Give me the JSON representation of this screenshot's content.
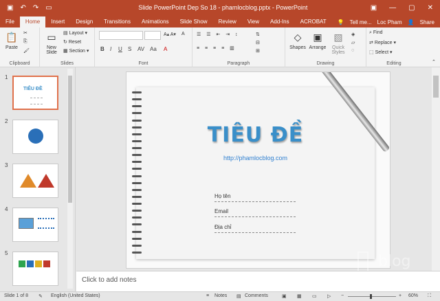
{
  "titlebar": {
    "title": "Slide PowerPoint Dep So 18 - phamlocblog.pptx - PowerPoint",
    "qa_icons": [
      "save-icon",
      "undo-icon",
      "redo-icon",
      "slideshow-icon"
    ],
    "user": "Loc Pham",
    "share": "Share",
    "tell_me": "Tell me..."
  },
  "tabs": [
    "File",
    "Home",
    "Insert",
    "Design",
    "Transitions",
    "Animations",
    "Slide Show",
    "Review",
    "View",
    "Add-Ins",
    "ACROBAT"
  ],
  "ribbon": {
    "clipboard": {
      "label": "Clipboard",
      "paste": "Paste"
    },
    "slides": {
      "label": "Slides",
      "new_slide": "New Slide",
      "layout": "Layout",
      "reset": "Reset",
      "section": "Section"
    },
    "font": {
      "label": "Font",
      "bold": "B",
      "italic": "I",
      "underline": "U",
      "strike": "S"
    },
    "paragraph": {
      "label": "Paragraph"
    },
    "drawing": {
      "label": "Drawing",
      "shapes": "Shapes",
      "arrange": "Arrange",
      "quick_styles": "Quick Styles"
    },
    "editing": {
      "label": "Editing",
      "find": "Find",
      "replace": "Replace",
      "select": "Select"
    }
  },
  "thumbnails": [
    {
      "number": "1",
      "selected": true
    },
    {
      "number": "2",
      "selected": false
    },
    {
      "number": "3",
      "selected": false
    },
    {
      "number": "4",
      "selected": false
    },
    {
      "number": "5",
      "selected": false
    }
  ],
  "slide": {
    "title": "TIÊU ĐỀ",
    "url": "http://phamlocblog.com",
    "fields": [
      "Họ tên",
      "Email",
      "Địa chỉ"
    ]
  },
  "notes": {
    "placeholder": "Click to add notes"
  },
  "status": {
    "slide": "Slide 1 of 8",
    "language": "English (United States)",
    "notes": "Notes",
    "comments": "Comments",
    "zoom": "60%"
  },
  "colors": {
    "accent": "#b7472a",
    "title": "#3a8fc9"
  }
}
